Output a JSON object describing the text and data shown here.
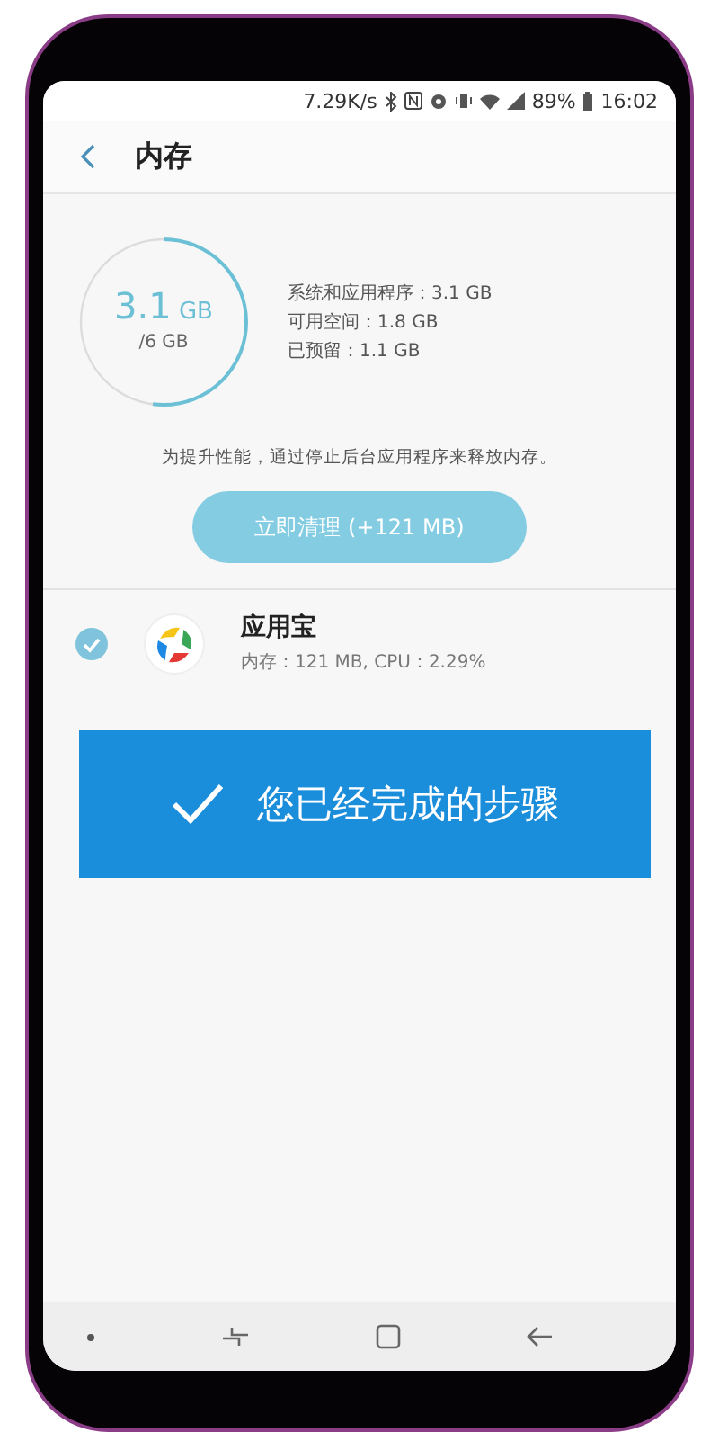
{
  "status_bar": {
    "speed": "7.29K/s",
    "battery": "89%",
    "time": "16:02"
  },
  "app_bar": {
    "title": "内存"
  },
  "memory": {
    "used": "3.1",
    "used_unit": "GB",
    "total": "/6 GB",
    "level": 0.52,
    "stats": [
      "系统和应用程序：3.1 GB",
      "可用空间：1.8 GB",
      "已预留：1.1 GB"
    ],
    "hint": "为提升性能，通过停止后台应用程序来释放内存。",
    "clean_button": "立即清理 (+121 MB)"
  },
  "apps": [
    {
      "name": "应用宝",
      "detail": "内存：121 MB, CPU：2.29%",
      "selected": true
    }
  ],
  "overlay": {
    "text": "您已经完成的步骤"
  }
}
